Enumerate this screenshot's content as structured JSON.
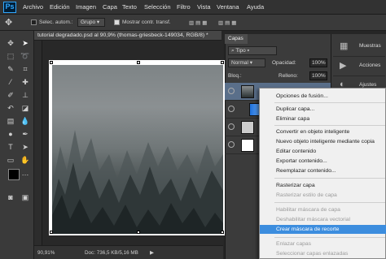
{
  "app": {
    "logo": "Ps"
  },
  "menu": [
    "Archivo",
    "Edición",
    "Imagen",
    "Capa",
    "Texto",
    "Selección",
    "Filtro",
    "Vista",
    "Ventana",
    "Ayuda"
  ],
  "options": {
    "autoselect_label": "Selec. autom.:",
    "group_value": "Grupo",
    "transform_label": "Mostrar contr. transf."
  },
  "document": {
    "tab_title": "tutorial degradado.psd al 90,9% (thomas-griesbeck-149034, RGB/8) *",
    "zoom": "90,91%",
    "doc_size": "Doc: 736,5 KB/5,16 MB"
  },
  "layers_panel": {
    "tab": "Capas",
    "filter_label": "Tipo",
    "blend_mode": "Normal",
    "opacity_label": "Opacidad:",
    "opacity_value": "100%",
    "lock_label": "Bloq.:",
    "fill_label": "Relleno:",
    "fill_value": "100%"
  },
  "dock": [
    {
      "label": "Muestras",
      "icon": "swatches-icon"
    },
    {
      "label": "Acciones",
      "icon": "play-icon"
    },
    {
      "label": "Ajustes",
      "icon": "adjust-icon"
    }
  ],
  "context_menu": {
    "items": [
      {
        "label": "Opciones de fusión...",
        "disabled": false
      },
      {
        "label": "Duplicar capa...",
        "disabled": false
      },
      {
        "label": "Eliminar capa",
        "disabled": false
      },
      {
        "label": "Convertir en objeto inteligente",
        "disabled": false
      },
      {
        "label": "Nuevo objeto inteligente mediante copia",
        "disabled": false
      },
      {
        "label": "Editar contenido",
        "disabled": false
      },
      {
        "label": "Exportar contenido...",
        "disabled": false
      },
      {
        "label": "Reemplazar contenido...",
        "disabled": false
      },
      {
        "label": "Rasterizar capa",
        "disabled": false
      },
      {
        "label": "Rasterizar estilo de capa",
        "disabled": true
      },
      {
        "label": "Habilitar máscara de capa",
        "disabled": true
      },
      {
        "label": "Deshabilitar máscara vectorial",
        "disabled": true
      },
      {
        "label": "Crear máscara de recorte",
        "disabled": false,
        "highlighted": true
      },
      {
        "label": "Enlazar capas",
        "disabled": true
      },
      {
        "label": "Seleccionar capas enlazadas",
        "disabled": true
      }
    ]
  },
  "colors": {
    "accent": "#3c8dde",
    "ps_blue": "#31a8ff"
  }
}
